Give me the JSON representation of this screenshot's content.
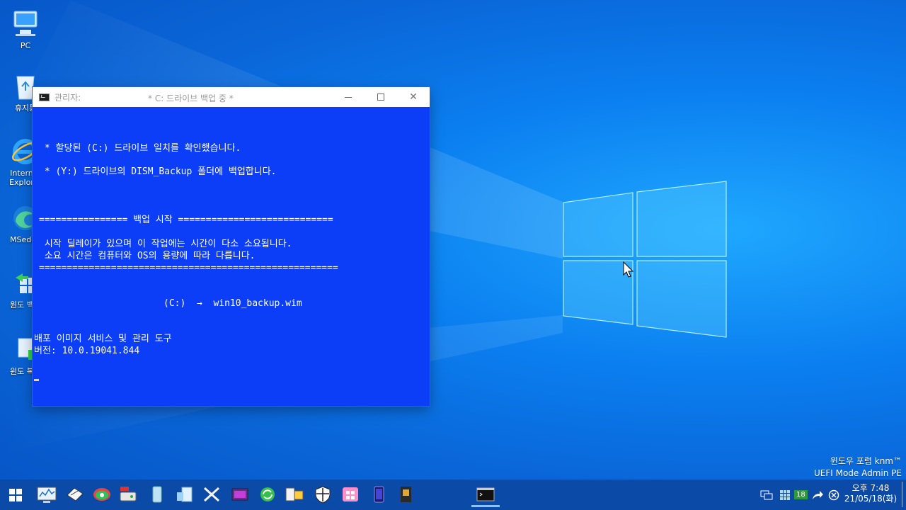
{
  "desktop": {
    "icons": [
      {
        "name": "pc",
        "label": "PC"
      },
      {
        "name": "recycle-bin",
        "label": "휴지통"
      },
      {
        "name": "internet-explorer",
        "label": "Internet\nExplorer"
      },
      {
        "name": "msedge",
        "label": "MSedge"
      },
      {
        "name": "windows-backup",
        "label": "윈도 백업"
      },
      {
        "name": "windows-restore",
        "label": "윈도 복원"
      }
    ]
  },
  "console": {
    "owner": "관리자:",
    "title": "* C: 드라이브 백업 중 *",
    "lines": [
      " * 할당된 (C:) 드라이브 일치를 확인했습니다.",
      " * (Y:) 드라이브의 DISM_Backup 폴더에 백업합니다.",
      "================ 백업 시작 ============================",
      " 시작 딜레이가 있으며 이 작업에는 시간이 다소 소요됩니다.",
      " 소요 시간은 컴퓨터와 OS의 용량에 따라 다릅니다.",
      "======================================================",
      "(C:)  →  win10_backup.wim",
      "배포 이미지 서비스 및 관리 도구",
      "버전: 10.0.19041.844"
    ]
  },
  "watermark": {
    "line1": "윈도우 포럼 knm™",
    "line2": "UEFI Mode Admin PE"
  },
  "taskbar": {
    "pinned": [
      "task-manager-icon",
      "disk-tool-icon",
      "network-icon",
      "partition-icon",
      "usb-drive-icon",
      "notepad-icon",
      "computer-manage-icon",
      "tools-icon",
      "media-icon",
      "refresh-icon",
      "explorer-icon",
      "shield-icon",
      "windows-store-icon",
      "phone-icon",
      "sd-card-icon",
      "console-icon"
    ],
    "tray_badge": "18",
    "clock": {
      "time": "오후 7:48",
      "date": "21/05/18(화)"
    }
  },
  "colors": {
    "console_bg": "#0b3ef6",
    "taskbar": "#0c4aa8",
    "desktop": "#0b7ff0"
  }
}
